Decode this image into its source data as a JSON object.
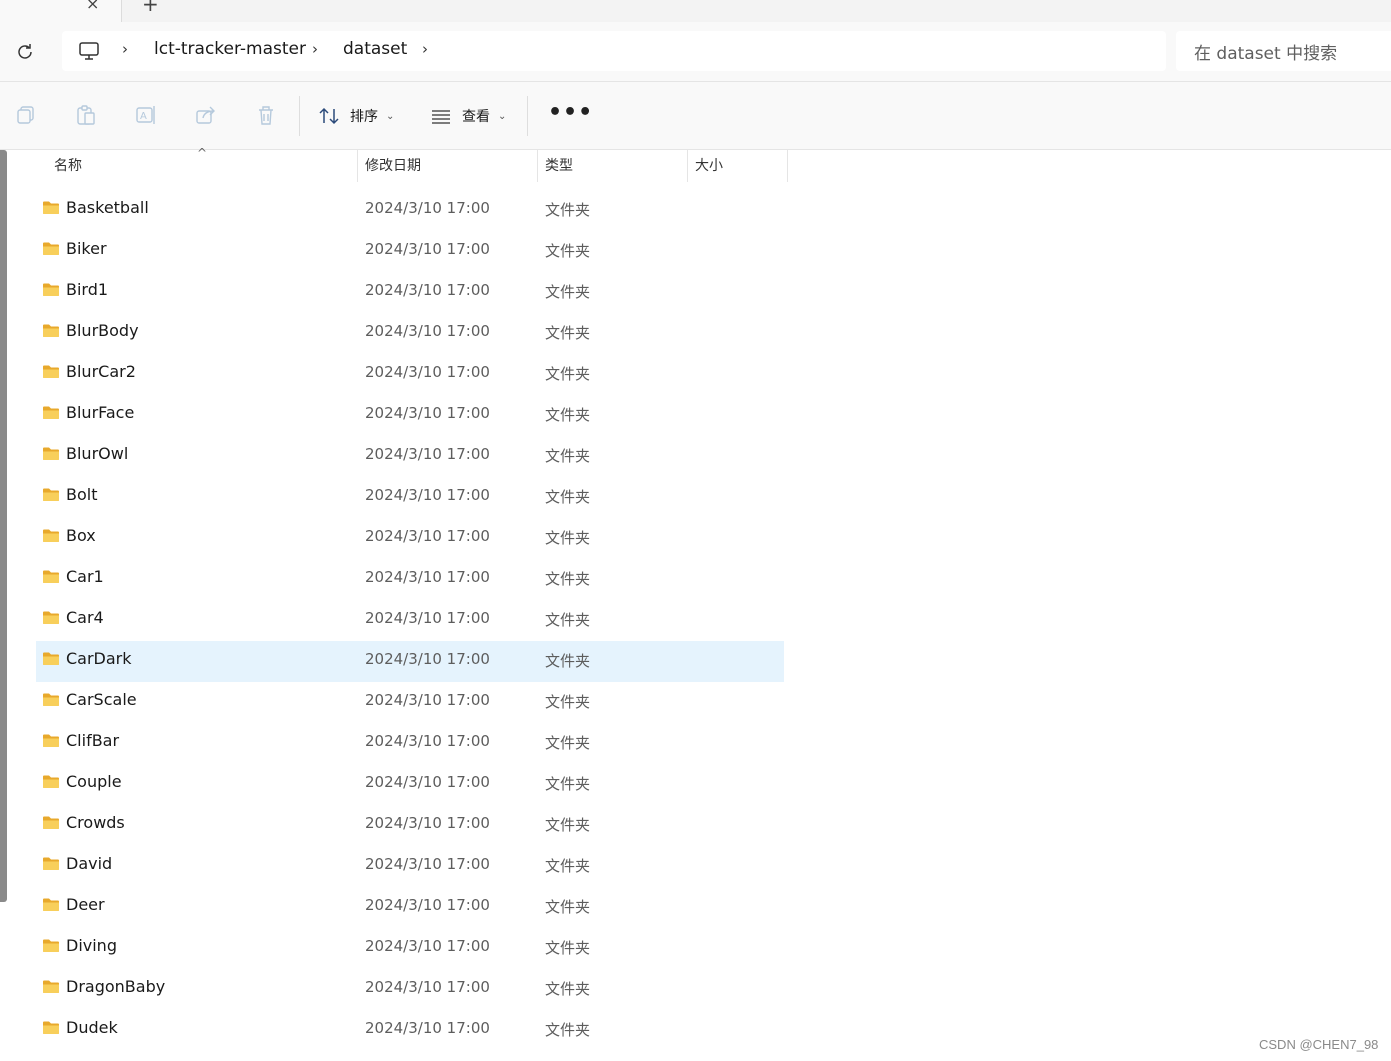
{
  "tabs": {
    "close_icon": "close-icon",
    "new_tab_icon": "plus-icon"
  },
  "address": {
    "breadcrumbs": [
      "lct-tracker-master",
      "dataset"
    ],
    "search_placeholder": "在 dataset 中搜索"
  },
  "toolbar": {
    "sort_label": "排序",
    "view_label": "查看",
    "more_label": "•••"
  },
  "columns": {
    "name": "名称",
    "modified": "修改日期",
    "type": "类型",
    "size": "大小"
  },
  "files": [
    {
      "name": "Basketball",
      "date": "2024/3/10 17:00",
      "type": "文件夹"
    },
    {
      "name": "Biker",
      "date": "2024/3/10 17:00",
      "type": "文件夹"
    },
    {
      "name": "Bird1",
      "date": "2024/3/10 17:00",
      "type": "文件夹"
    },
    {
      "name": "BlurBody",
      "date": "2024/3/10 17:00",
      "type": "文件夹"
    },
    {
      "name": "BlurCar2",
      "date": "2024/3/10 17:00",
      "type": "文件夹"
    },
    {
      "name": "BlurFace",
      "date": "2024/3/10 17:00",
      "type": "文件夹"
    },
    {
      "name": "BlurOwl",
      "date": "2024/3/10 17:00",
      "type": "文件夹"
    },
    {
      "name": "Bolt",
      "date": "2024/3/10 17:00",
      "type": "文件夹"
    },
    {
      "name": "Box",
      "date": "2024/3/10 17:00",
      "type": "文件夹"
    },
    {
      "name": "Car1",
      "date": "2024/3/10 17:00",
      "type": "文件夹"
    },
    {
      "name": "Car4",
      "date": "2024/3/10 17:00",
      "type": "文件夹"
    },
    {
      "name": "CarDark",
      "date": "2024/3/10 17:00",
      "type": "文件夹",
      "selected": true
    },
    {
      "name": "CarScale",
      "date": "2024/3/10 17:00",
      "type": "文件夹"
    },
    {
      "name": "ClifBar",
      "date": "2024/3/10 17:00",
      "type": "文件夹"
    },
    {
      "name": "Couple",
      "date": "2024/3/10 17:00",
      "type": "文件夹"
    },
    {
      "name": "Crowds",
      "date": "2024/3/10 17:00",
      "type": "文件夹"
    },
    {
      "name": "David",
      "date": "2024/3/10 17:00",
      "type": "文件夹"
    },
    {
      "name": "Deer",
      "date": "2024/3/10 17:00",
      "type": "文件夹"
    },
    {
      "name": "Diving",
      "date": "2024/3/10 17:00",
      "type": "文件夹"
    },
    {
      "name": "DragonBaby",
      "date": "2024/3/10 17:00",
      "type": "文件夹"
    },
    {
      "name": "Dudek",
      "date": "2024/3/10 17:00",
      "type": "文件夹"
    }
  ],
  "colors": {
    "selection": "#e5f3fd",
    "folder": "#f5c242"
  },
  "watermark": "CSDN @CHEN7_98"
}
